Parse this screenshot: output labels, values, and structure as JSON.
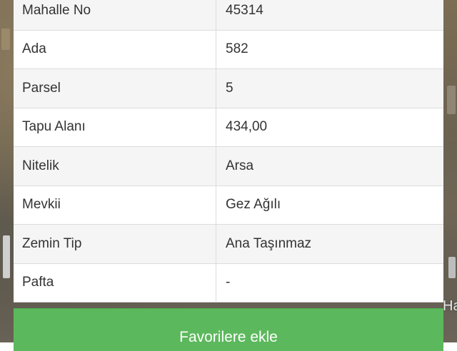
{
  "table": {
    "rows": [
      {
        "label": "Mahalle No",
        "value": "45314"
      },
      {
        "label": "Ada",
        "value": "582"
      },
      {
        "label": "Parsel",
        "value": "5"
      },
      {
        "label": "Tapu Alanı",
        "value": "434,00"
      },
      {
        "label": "Nitelik",
        "value": "Arsa"
      },
      {
        "label": "Mevkii",
        "value": "Gez Ağılı"
      },
      {
        "label": "Zemin Tip",
        "value": "Ana Taşınmaz"
      },
      {
        "label": "Pafta",
        "value": "-"
      }
    ]
  },
  "actions": {
    "favorite_label": "Favorilere ekle"
  },
  "map": {
    "label_fragment": "Ha"
  },
  "colors": {
    "button_green": "#5cb85c",
    "row_alt": "#f5f5f5",
    "border": "#dcdcdc",
    "text": "#333333"
  }
}
